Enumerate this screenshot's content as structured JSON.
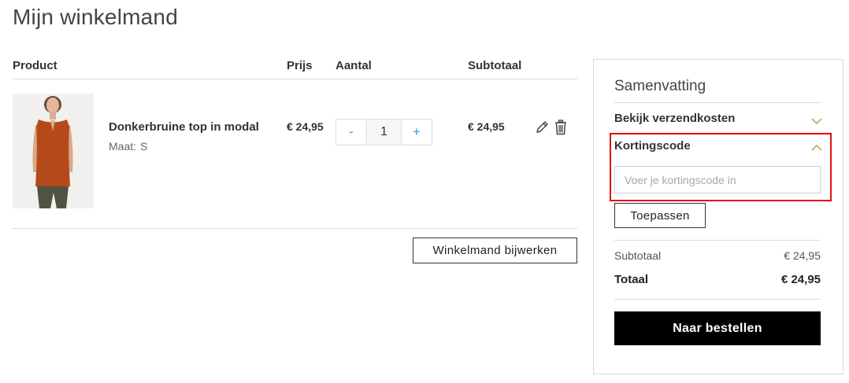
{
  "page": {
    "title": "Mijn winkelmand"
  },
  "cart": {
    "headers": {
      "product": "Product",
      "price": "Prijs",
      "quantity": "Aantal",
      "subtotal": "Subtotaal"
    },
    "items": [
      {
        "name": "Donkerbruine top in modal",
        "size_label": "Maat:",
        "size": "S",
        "price": "€ 24,95",
        "quantity": "1",
        "qty_minus": "-",
        "qty_plus": "+",
        "subtotal": "€ 24,95",
        "image_icon": "product-photo-top"
      }
    ],
    "update_button": "Winkelmand bijwerken"
  },
  "summary": {
    "title": "Samenvatting",
    "shipping_label": "Bekijk verzendkosten",
    "coupon_label": "Kortingscode",
    "coupon_placeholder": "Voer je kortingscode in",
    "apply_button": "Toepassen",
    "subtotal_label": "Subtotaal",
    "subtotal_value": "€ 24,95",
    "total_label": "Totaal",
    "total_value": "€ 24,95",
    "checkout_button": "Naar bestellen"
  },
  "colors": {
    "accent_blue": "#2a9fd6",
    "chevron_tan": "#c9a36b",
    "highlight_red": "#e01010",
    "checkout_bg": "#000000"
  }
}
